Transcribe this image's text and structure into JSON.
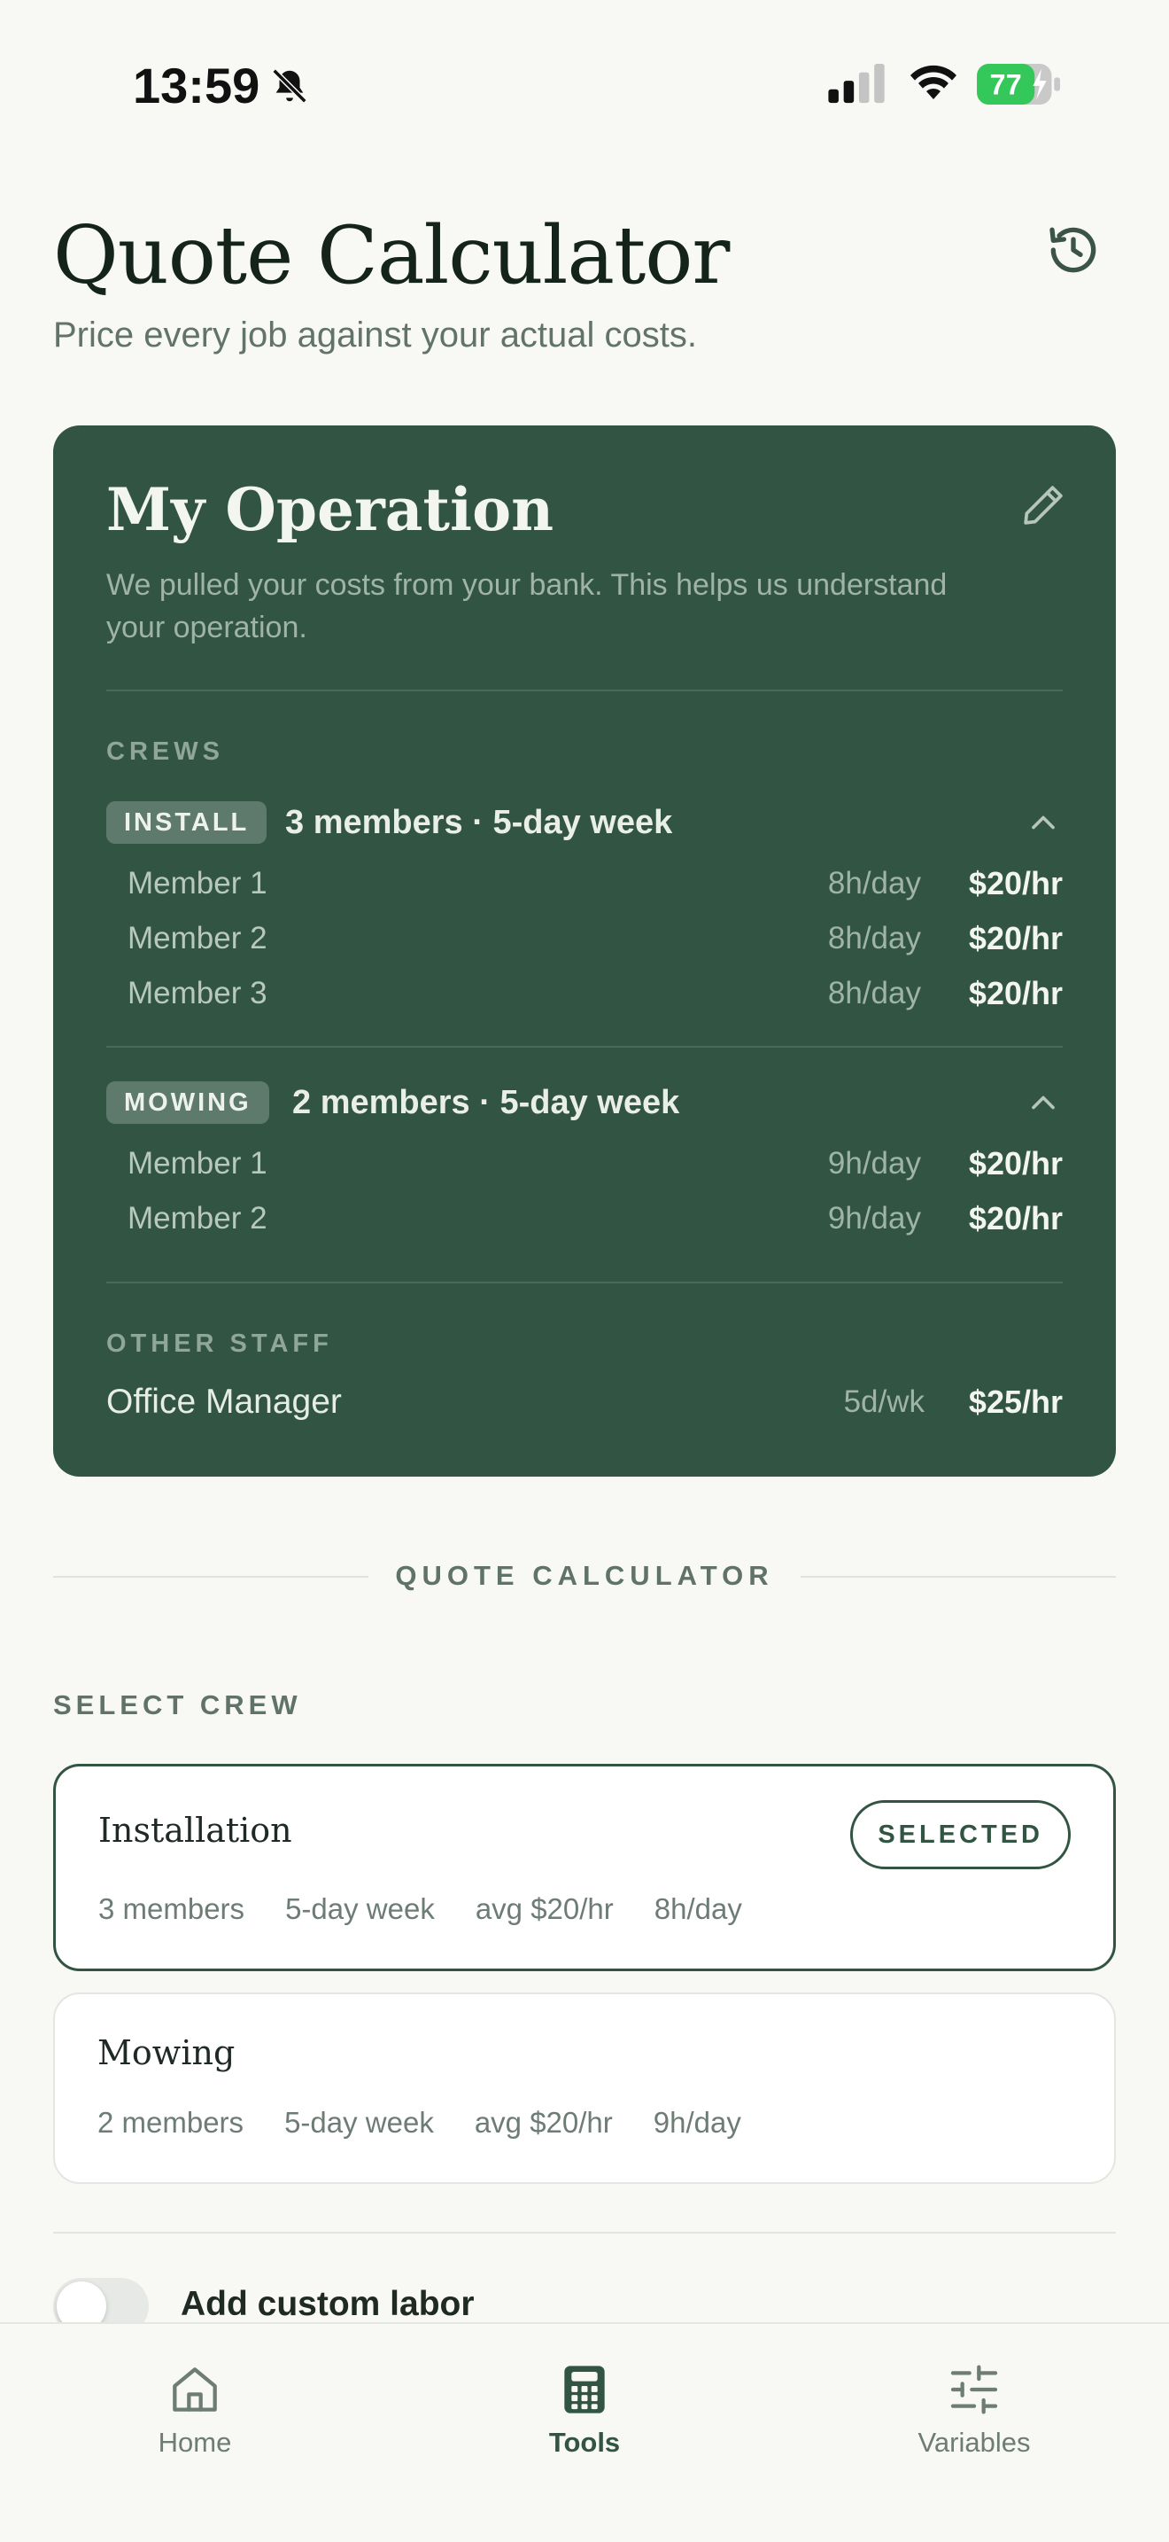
{
  "status_bar": {
    "time": "13:59",
    "battery": "77"
  },
  "header": {
    "title": "Quote Calculator",
    "subtitle": "Price every job against your actual costs."
  },
  "operation": {
    "title": "My Operation",
    "description": "We pulled your costs from your bank. This helps us understand your operation.",
    "crews_label": "CREWS",
    "crews": [
      {
        "tag": "INSTALL",
        "summary": "3 members · 5-day week",
        "members": [
          {
            "name": "Member 1",
            "hours": "8h/day",
            "rate": "$20/hr"
          },
          {
            "name": "Member 2",
            "hours": "8h/day",
            "rate": "$20/hr"
          },
          {
            "name": "Member 3",
            "hours": "8h/day",
            "rate": "$20/hr"
          }
        ]
      },
      {
        "tag": "MOWING",
        "summary": "2 members · 5-day week",
        "members": [
          {
            "name": "Member 1",
            "hours": "9h/day",
            "rate": "$20/hr"
          },
          {
            "name": "Member 2",
            "hours": "9h/day",
            "rate": "$20/hr"
          }
        ]
      }
    ],
    "other_staff_label": "OTHER STAFF",
    "other_staff": [
      {
        "name": "Office Manager",
        "days": "5d/wk",
        "rate": "$25/hr"
      }
    ]
  },
  "quote": {
    "section_label": "QUOTE CALCULATOR",
    "select_crew_label": "SELECT CREW",
    "crew_options": [
      {
        "name": "Installation",
        "members": "3 members",
        "week": "5-day week",
        "avg": "avg $20/hr",
        "hours": "8h/day",
        "badge": "SELECTED"
      },
      {
        "name": "Mowing",
        "members": "2 members",
        "week": "5-day week",
        "avg": "avg $20/hr",
        "hours": "9h/day"
      }
    ],
    "custom_labor_label": "Add custom labor"
  },
  "tabs": [
    {
      "label": "Home",
      "icon": "home-icon"
    },
    {
      "label": "Tools",
      "icon": "calculator-icon"
    },
    {
      "label": "Variables",
      "icon": "sliders-icon"
    }
  ],
  "colors": {
    "accent": "#325443",
    "background": "#f8f8f5",
    "battery": "#34c759"
  }
}
